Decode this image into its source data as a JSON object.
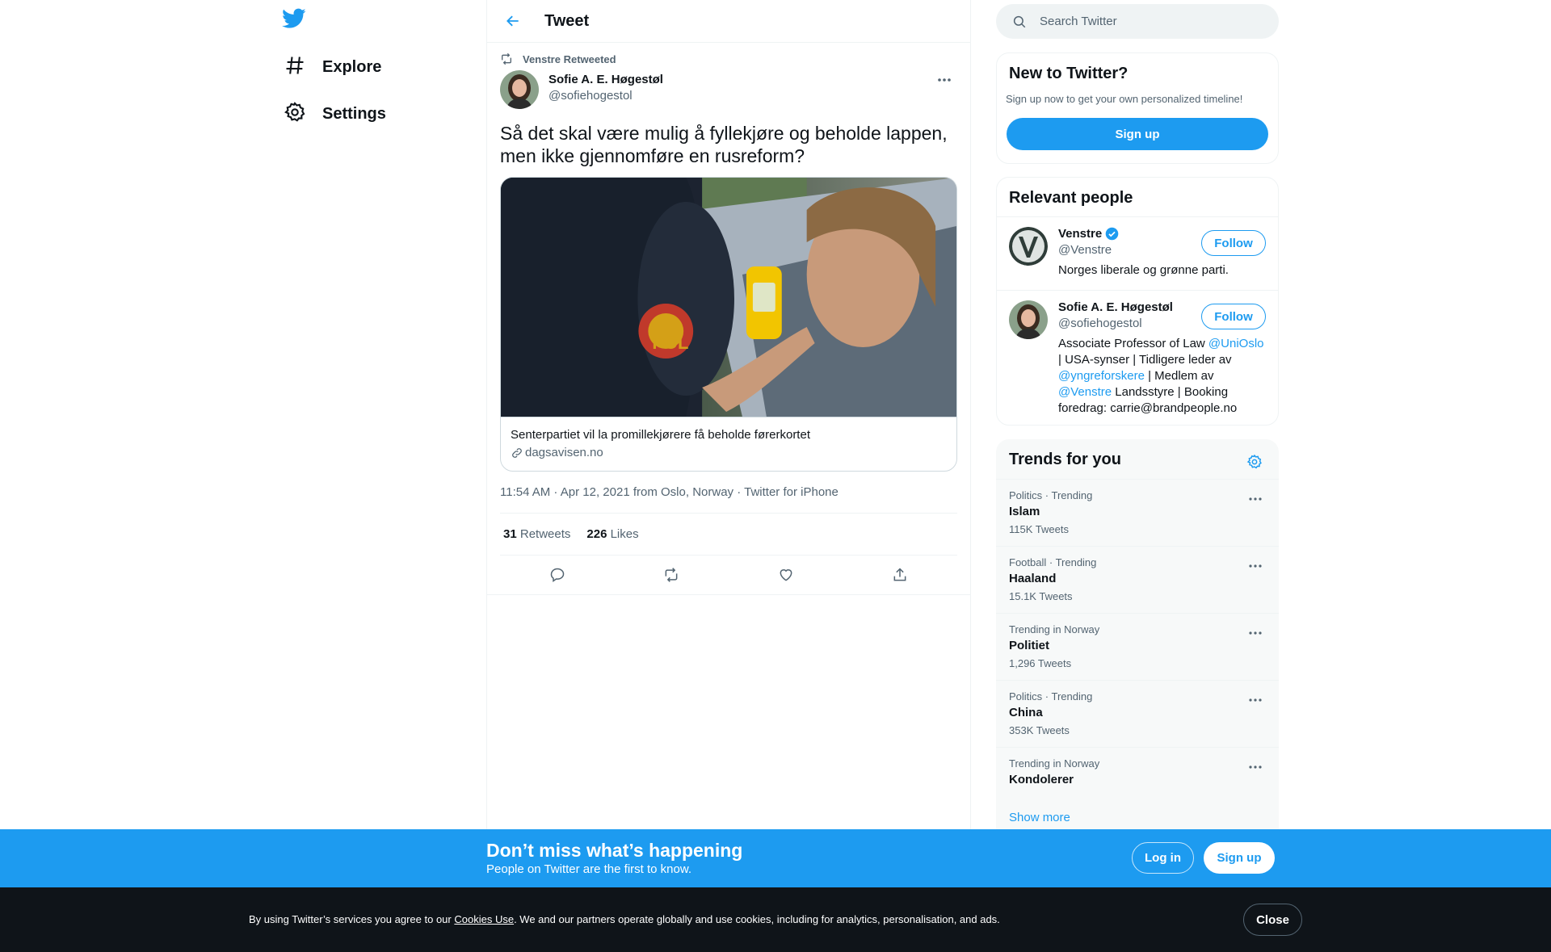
{
  "nav": {
    "logo_icon": "twitter-bird-icon",
    "items": [
      {
        "label": "Explore",
        "icon": "hashtag-icon"
      },
      {
        "label": "Settings",
        "icon": "gear-icon"
      }
    ]
  },
  "header": {
    "title": "Tweet"
  },
  "tweet": {
    "retweet_context": "Venstre Retweeted",
    "author_name": "Sofie A. E. Høgestøl",
    "author_handle": "@sofiehogestol",
    "text": "Så det skal være mulig å fyllekjøre og beholde lappen, men ikke gjennomføre en rusreform?",
    "card": {
      "title": "Senterpartiet vil la promillekjørere få beholde førerkortet",
      "domain": "dagsavisen.no"
    },
    "meta": {
      "timestamp": "11:54 AM · Apr 12, 2021",
      "from_text": "from",
      "location": "Oslo, Norway",
      "separator": "·",
      "source": "Twitter for iPhone"
    },
    "stats": {
      "retweets_count": "31",
      "retweets_label": "Retweets",
      "likes_count": "226",
      "likes_label": "Likes"
    }
  },
  "search": {
    "placeholder": "Search Twitter"
  },
  "new_to_twitter": {
    "title": "New to Twitter?",
    "subtitle": "Sign up now to get your own personalized timeline!",
    "button": "Sign up"
  },
  "relevant_people": {
    "title": "Relevant people",
    "follow_label": "Follow",
    "people": [
      {
        "name": "Venstre",
        "handle": "@Venstre",
        "verified": true,
        "bio": "Norges liberale og grønne parti."
      },
      {
        "name": "Sofie A. E. Høgestøl",
        "handle": "@sofiehogestol",
        "verified": false,
        "bio_parts": [
          "Associate Professor of Law ",
          "@UniOslo",
          " | USA-synser | Tidligere leder av ",
          "@yngreforskere",
          " | Medlem av ",
          "@Venstre",
          " Landsstyre | Booking foredrag: carrie@brandpeople.no"
        ]
      }
    ]
  },
  "trends": {
    "title": "Trends for you",
    "items": [
      {
        "context": "Politics · Trending",
        "name": "Islam",
        "count": "115K Tweets"
      },
      {
        "context": "Football · Trending",
        "name": "Haaland",
        "count": "15.1K Tweets"
      },
      {
        "context": "Trending in Norway",
        "name": "Politiet",
        "count": "1,296 Tweets"
      },
      {
        "context": "Politics · Trending",
        "name": "China",
        "count": "353K Tweets"
      },
      {
        "context": "Trending in Norway",
        "name": "Kondolerer",
        "count": ""
      }
    ],
    "show_more": "Show more"
  },
  "bottom_bar": {
    "title": "Don’t miss what’s happening",
    "subtitle": "People on Twitter are the first to know.",
    "login": "Log in",
    "signup": "Sign up"
  },
  "cookie": {
    "text_before": "By using Twitter’s services you agree to our ",
    "link": "Cookies Use",
    "text_after": ". We and our partners operate globally and use cookies, including for analytics, personalisation, and ads.",
    "close": "Close"
  },
  "colors": {
    "accent": "#1d9bf0",
    "text": "#0f1419",
    "secondary": "#536471",
    "cookie_bg": "#0f1419"
  }
}
